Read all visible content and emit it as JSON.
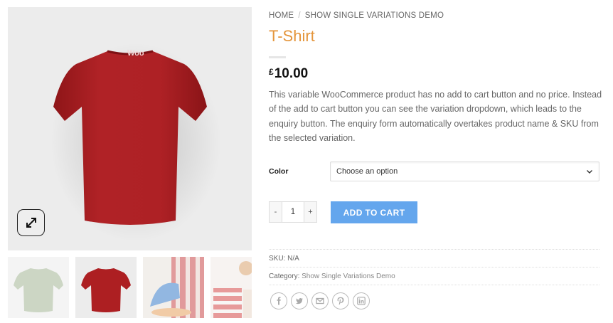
{
  "breadcrumb": {
    "home": "Home",
    "separator": "/",
    "category": "Show Single Variations Demo"
  },
  "product": {
    "title": "T-Shirt",
    "price_currency": "£",
    "price_amount": "10.00",
    "description": "This variable WooCommerce product has no add to cart button and no price. Instead of the add to cart button you can see the variation dropdown, which leads to the enquiry button. The enquiry form automatically overtakes product name & SKU from the selected variation.",
    "logo_text": "Woo"
  },
  "variation": {
    "label": "Color",
    "selected": "Choose an option"
  },
  "quantity": {
    "minus": "-",
    "value": "1",
    "plus": "+"
  },
  "cart": {
    "button_label": "Add to cart"
  },
  "meta": {
    "sku_label": "SKU:",
    "sku_value": "N/A",
    "category_label": "Category:",
    "category_value": "Show Single Variations Demo"
  },
  "share_icons": [
    "facebook-icon",
    "twitter-icon",
    "email-icon",
    "pinterest-icon",
    "linkedin-icon"
  ],
  "colors": {
    "title": "#e4953b",
    "cart_button": "#64a6ed",
    "shirt_red": "#ad1f22",
    "shirt_green": "#a3b594"
  }
}
